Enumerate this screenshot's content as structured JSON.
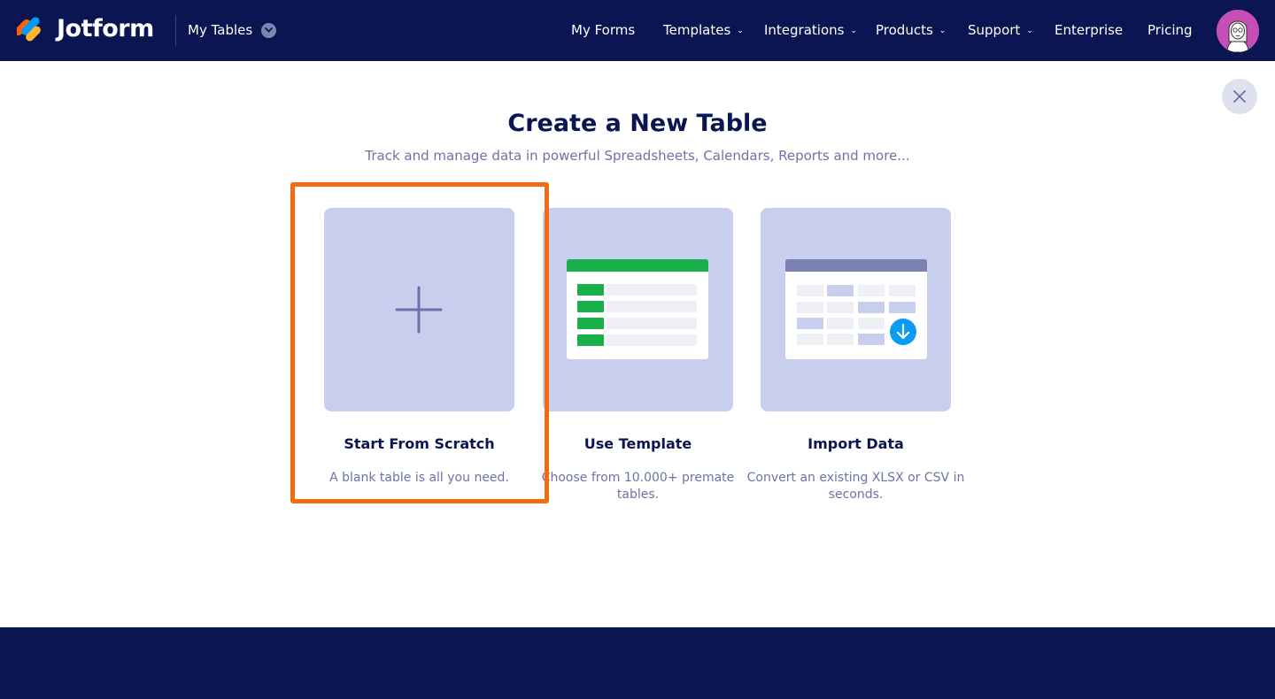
{
  "header": {
    "brand": "Jotform",
    "product_switch": "My Tables",
    "nav": [
      {
        "label": "My Forms",
        "has_dropdown": false
      },
      {
        "label": "Templates",
        "has_dropdown": true
      },
      {
        "label": "Integrations",
        "has_dropdown": true
      },
      {
        "label": "Products",
        "has_dropdown": true
      },
      {
        "label": "Support",
        "has_dropdown": true
      },
      {
        "label": "Enterprise",
        "has_dropdown": false
      },
      {
        "label": "Pricing",
        "has_dropdown": false
      }
    ],
    "caret_glyph": "⌄"
  },
  "main": {
    "title": "Create a New Table",
    "subtitle": "Track and manage data in powerful Spreadsheets, Calendars, Reports and more...",
    "options": [
      {
        "title": "Start From Scratch",
        "description": "A blank table is all you need.",
        "icon": "plus-icon",
        "highlighted": true
      },
      {
        "title": "Use Template",
        "description": "Choose from 10.000+ premate tables.",
        "icon": "template-table-icon",
        "highlighted": false
      },
      {
        "title": "Import Data",
        "description": "Convert an existing XLSX or CSV in seconds.",
        "icon": "import-table-icon",
        "highlighted": false
      }
    ]
  },
  "colors": {
    "navy": "#0a1551",
    "card_bg": "#c8ceee",
    "highlight": "#f26a12",
    "green": "#18b04a",
    "import_blue": "#0a9cf5",
    "subtext": "#6c73a8"
  }
}
